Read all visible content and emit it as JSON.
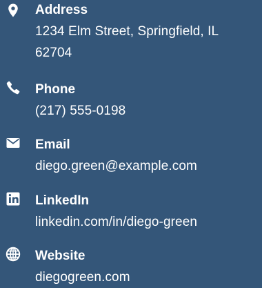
{
  "contact": {
    "address": {
      "icon": "map-marker-icon",
      "label": "Address",
      "value": "1234 Elm Street, Springfield, IL 62704"
    },
    "phone": {
      "icon": "phone-icon",
      "label": "Phone",
      "value": "(217) 555-0198"
    },
    "email": {
      "icon": "envelope-icon",
      "label": "Email",
      "value": "diego.green@example.com"
    },
    "linkedin": {
      "icon": "linkedin-icon",
      "label": "LinkedIn",
      "value": "linkedin.com/in/diego-green"
    },
    "website": {
      "icon": "globe-icon",
      "label": "Website",
      "value": "diegogreen.com"
    }
  },
  "colors": {
    "background": "#345679",
    "text": "#ffffff"
  }
}
